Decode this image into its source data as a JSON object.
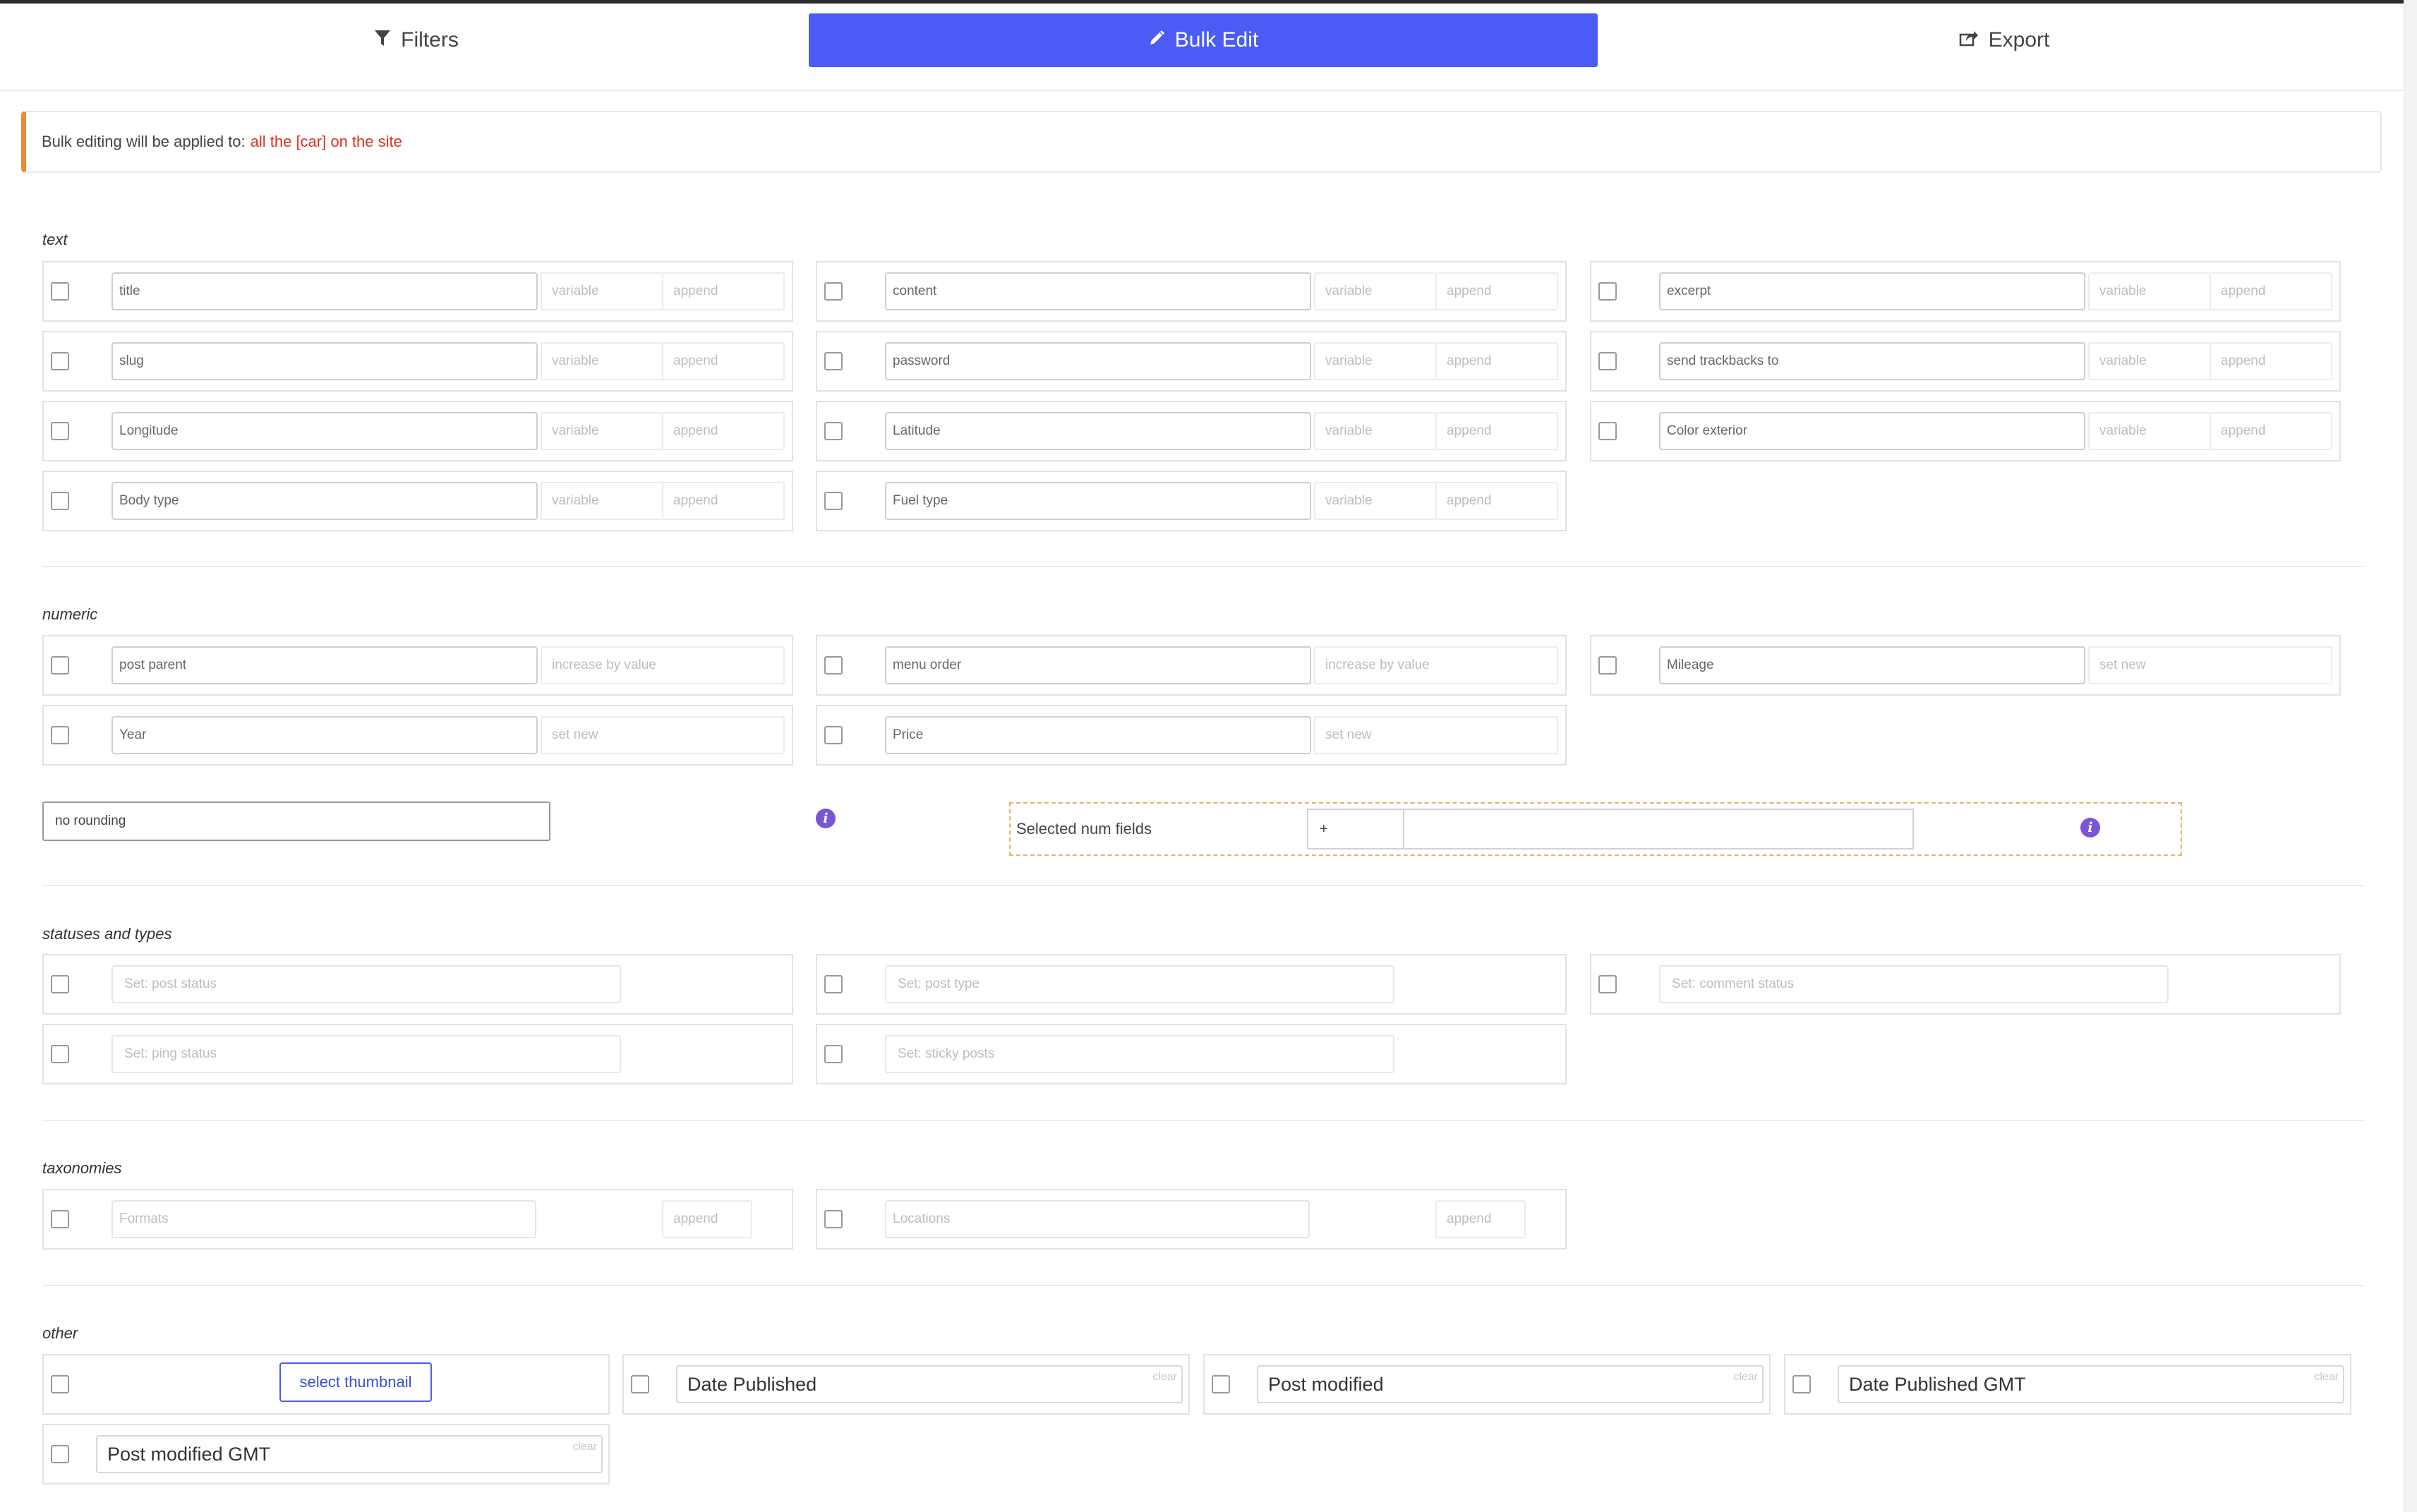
{
  "tabs": {
    "filters": "Filters",
    "bulk_edit": "Bulk Edit",
    "export": "Export"
  },
  "notice": {
    "text": "Bulk editing will be applied to:",
    "target": "all the [car] on the site"
  },
  "sections": {
    "text": "text",
    "numeric": "numeric",
    "statuses": "statuses and types",
    "taxonomies": "taxonomies",
    "other": "other"
  },
  "text_fields": [
    {
      "label": "title",
      "mode": "variable",
      "action": "append"
    },
    {
      "label": "content",
      "mode": "variable",
      "action": "append"
    },
    {
      "label": "excerpt",
      "mode": "variable",
      "action": "append"
    },
    {
      "label": "slug",
      "mode": "variable",
      "action": "append"
    },
    {
      "label": "password",
      "mode": "variable",
      "action": "append"
    },
    {
      "label": "send trackbacks to",
      "mode": "variable",
      "action": "append"
    },
    {
      "label": "Longitude",
      "mode": "variable",
      "action": "append"
    },
    {
      "label": "Latitude",
      "mode": "variable",
      "action": "append"
    },
    {
      "label": "Color exterior",
      "mode": "variable",
      "action": "append"
    },
    {
      "label": "Body type",
      "mode": "variable",
      "action": "append"
    },
    {
      "label": "Fuel type",
      "mode": "variable",
      "action": "append"
    }
  ],
  "numeric_fields": [
    {
      "label": "post parent",
      "action": "increase by value"
    },
    {
      "label": "menu order",
      "action": "increase by value"
    },
    {
      "label": "Mileage",
      "action": "set new"
    },
    {
      "label": "Year",
      "action": "set new"
    },
    {
      "label": "Price",
      "action": "set new"
    }
  ],
  "rounding": "no rounding",
  "selected_num_fields": {
    "label": "Selected num fields",
    "operator": "+"
  },
  "status_fields": [
    {
      "placeholder": "Set: post status"
    },
    {
      "placeholder": "Set: post type"
    },
    {
      "placeholder": "Set: comment status"
    },
    {
      "placeholder": "Set: ping status"
    },
    {
      "placeholder": "Set: sticky posts"
    }
  ],
  "taxonomy_fields": [
    {
      "placeholder": "Formats",
      "action": "append"
    },
    {
      "placeholder": "Locations",
      "action": "append"
    }
  ],
  "other": {
    "thumbnail_button": "select thumbnail",
    "clear_label": "clear",
    "dates": [
      {
        "label": "Date Published"
      },
      {
        "label": "Post modified"
      },
      {
        "label": "Date Published GMT"
      },
      {
        "label": "Post modified GMT"
      }
    ]
  },
  "colors": {
    "primary": "#4a5cf5",
    "notice_border": "#e88a3c",
    "notice_target": "#e0301e",
    "info_icon": "#7b55d6"
  },
  "icons": {
    "filters": "funnel-icon",
    "bulk_edit": "pencil-icon",
    "export": "share-export-icon",
    "info": "info-icon"
  }
}
